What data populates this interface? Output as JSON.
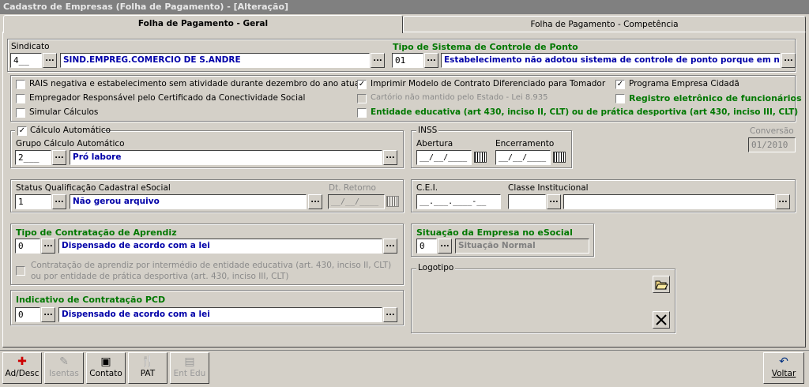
{
  "window": {
    "title": "Cadastro de Empresas (Folha de Pagamento) - [Alteração]"
  },
  "tabs": [
    {
      "label": "Folha de Pagamento - Geral"
    },
    {
      "label": "Folha de Pagamento - Competência"
    }
  ],
  "sindicato": {
    "label": "Sindicato",
    "code": "4__",
    "name": "SIND.EMPREG.COMERCIO DE S.ANDRE"
  },
  "ponto": {
    "label": "Tipo de Sistema de Controle de Ponto",
    "code": "01",
    "desc": "Estabelecimento não adotou sistema de controle de ponto porque em nenhu"
  },
  "checks": {
    "rais": {
      "label": "RAIS negativa e estabelecimento sem atividade durante dezembro do ano atual",
      "checked": false
    },
    "empregador": {
      "label": "Empregador Responsável pelo Certificado da Conectividade Social",
      "checked": false
    },
    "simular": {
      "label": "Simular Cálculos",
      "checked": false
    },
    "imprimir": {
      "label": "Imprimir Modelo de Contrato Diferenciado para Tomador",
      "checked": true
    },
    "cartorio": {
      "label": "Cartório não mantido pelo Estado - Lei 8.935",
      "checked": false
    },
    "entidade": {
      "label": "Entidade educativa (art 430, inciso II, CLT) ou de prática desportiva (art 430, inciso III, CLT)",
      "checked": false
    },
    "cidada": {
      "label": "Programa Empresa Cidadã",
      "checked": true
    },
    "registro": {
      "label": "Registro eletrônico de funcionários",
      "checked": false
    }
  },
  "calculo": {
    "label": "Cálculo Automático",
    "checked": true,
    "group_label": "Grupo Cálculo Automático",
    "code": "2___",
    "name": "Pró labore"
  },
  "inss": {
    "label": "INSS",
    "abertura_label": "Abertura",
    "abertura": "__/__/____",
    "encerramento_label": "Encerramento",
    "encerramento": "__/__/____"
  },
  "conversao": {
    "label": "Conversão",
    "value": "01/2010"
  },
  "status": {
    "label": "Status Qualificação Cadastral eSocial",
    "code": "1",
    "name": "Não gerou arquivo",
    "retorno_label": "Dt. Retorno",
    "retorno": "__/__/____"
  },
  "cei": {
    "label": "C.E.I.",
    "value": "__.___.____-__",
    "classe_label": "Classe Institucional"
  },
  "aprendiz": {
    "label": "Tipo de Contratação de Aprendiz",
    "code": "0",
    "name": "Dispensado de acordo com a lei",
    "check_label": "Contratação de aprendiz por intermédio de entidade educativa (art. 430, inciso II, CLT) ou por entidade de prática desportiva (art. 430, inciso III, CLT)"
  },
  "situacao": {
    "label": "Situação da Empresa no eSocial",
    "code": "0",
    "name": "Situação Normal"
  },
  "logotipo": {
    "label": "Logotipo"
  },
  "pcd": {
    "label": "Indicativo de Contratação PCD",
    "code": "0",
    "name": "Dispensado de acordo com a lei"
  },
  "ellipsis": "...",
  "toolbar": {
    "ad_desc": "Ad/Desc",
    "isentas": "Isentas",
    "contato": "Contato",
    "pat": "PAT",
    "ent_edu": "Ent Edu",
    "voltar": "Voltar"
  }
}
